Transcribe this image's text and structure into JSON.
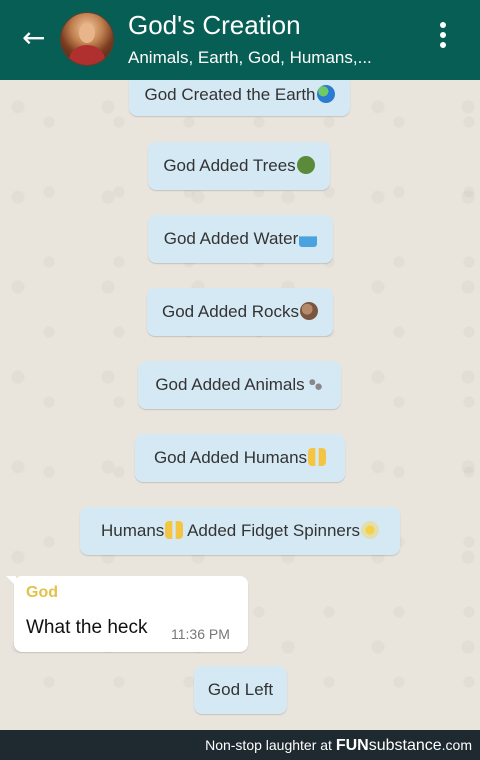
{
  "header": {
    "title": "God's Creation",
    "subtitle": "Animals, Earth, God, Humans,...",
    "colors": {
      "bar": "#075e54",
      "text": "#ffffff"
    }
  },
  "icons": {
    "back": "arrow-left-icon",
    "menu": "vertical-dots-icon",
    "avatar": "jesus-portrait"
  },
  "system_messages": [
    {
      "text": "God Created the Earth",
      "emoji": "globe"
    },
    {
      "text": "God Added Trees",
      "emoji": "tree"
    },
    {
      "text": "God Added Water",
      "emoji": "wave"
    },
    {
      "text": "God Added Rocks",
      "emoji": "rock"
    },
    {
      "text": "God Added Animals",
      "emoji": "paw-prints"
    },
    {
      "text": "God Added Humans",
      "emoji": "people"
    },
    {
      "text": "Humans",
      "text_after": " Added Fidget Spinners",
      "emoji": "people",
      "emoji_after": "sun"
    }
  ],
  "message": {
    "sender": "God",
    "text": "What the heck",
    "time": "11:36 PM"
  },
  "final_notice": {
    "text": "God Left"
  },
  "watermark": {
    "prefix": "Non-stop laughter at ",
    "brand_bold": "FUN",
    "brand_rest": "substance",
    "suffix": ".com"
  }
}
